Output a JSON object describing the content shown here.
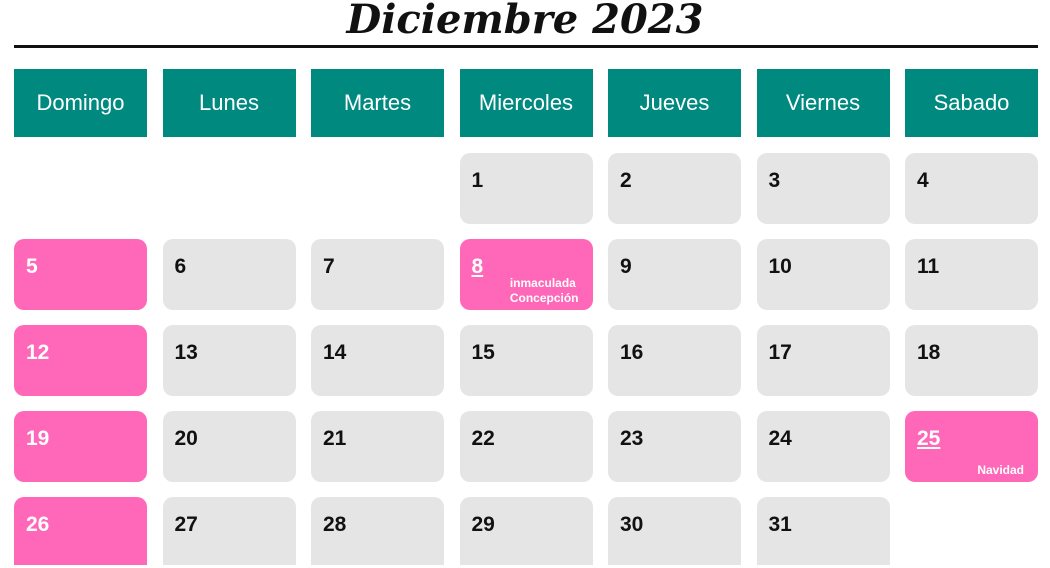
{
  "calendar": {
    "title": "Diciembre 2023",
    "weekdays": [
      "Domingo",
      "Lunes",
      "Martes",
      "Miercoles",
      "Jueves",
      "Viernes",
      "Sabado"
    ],
    "colors": {
      "header": "#00897f",
      "day": "#e5e5e5",
      "holiday": "#ff68b8"
    },
    "days": [
      {
        "num": "",
        "holiday": false,
        "empty": true
      },
      {
        "num": "",
        "holiday": false,
        "empty": true
      },
      {
        "num": "",
        "holiday": false,
        "empty": true
      },
      {
        "num": "1",
        "holiday": false
      },
      {
        "num": "2",
        "holiday": false
      },
      {
        "num": "3",
        "holiday": false
      },
      {
        "num": "4",
        "holiday": false
      },
      {
        "num": "5",
        "holiday": true
      },
      {
        "num": "6",
        "holiday": false
      },
      {
        "num": "7",
        "holiday": false
      },
      {
        "num": "8",
        "holiday": true,
        "underline": true,
        "note": "inmaculada\nConcepción"
      },
      {
        "num": "9",
        "holiday": false
      },
      {
        "num": "10",
        "holiday": false
      },
      {
        "num": "11",
        "holiday": false
      },
      {
        "num": "12",
        "holiday": true
      },
      {
        "num": "13",
        "holiday": false
      },
      {
        "num": "14",
        "holiday": false
      },
      {
        "num": "15",
        "holiday": false
      },
      {
        "num": "16",
        "holiday": false
      },
      {
        "num": "17",
        "holiday": false
      },
      {
        "num": "18",
        "holiday": false
      },
      {
        "num": "19",
        "holiday": true
      },
      {
        "num": "20",
        "holiday": false
      },
      {
        "num": "21",
        "holiday": false
      },
      {
        "num": "22",
        "holiday": false
      },
      {
        "num": "23",
        "holiday": false
      },
      {
        "num": "24",
        "holiday": false
      },
      {
        "num": "25",
        "holiday": true,
        "underline": true,
        "note": "Navidad"
      },
      {
        "num": "26",
        "holiday": true
      },
      {
        "num": "27",
        "holiday": false
      },
      {
        "num": "28",
        "holiday": false
      },
      {
        "num": "29",
        "holiday": false
      },
      {
        "num": "30",
        "holiday": false
      },
      {
        "num": "31",
        "holiday": false
      },
      {
        "num": "",
        "holiday": false,
        "empty": true
      }
    ]
  }
}
